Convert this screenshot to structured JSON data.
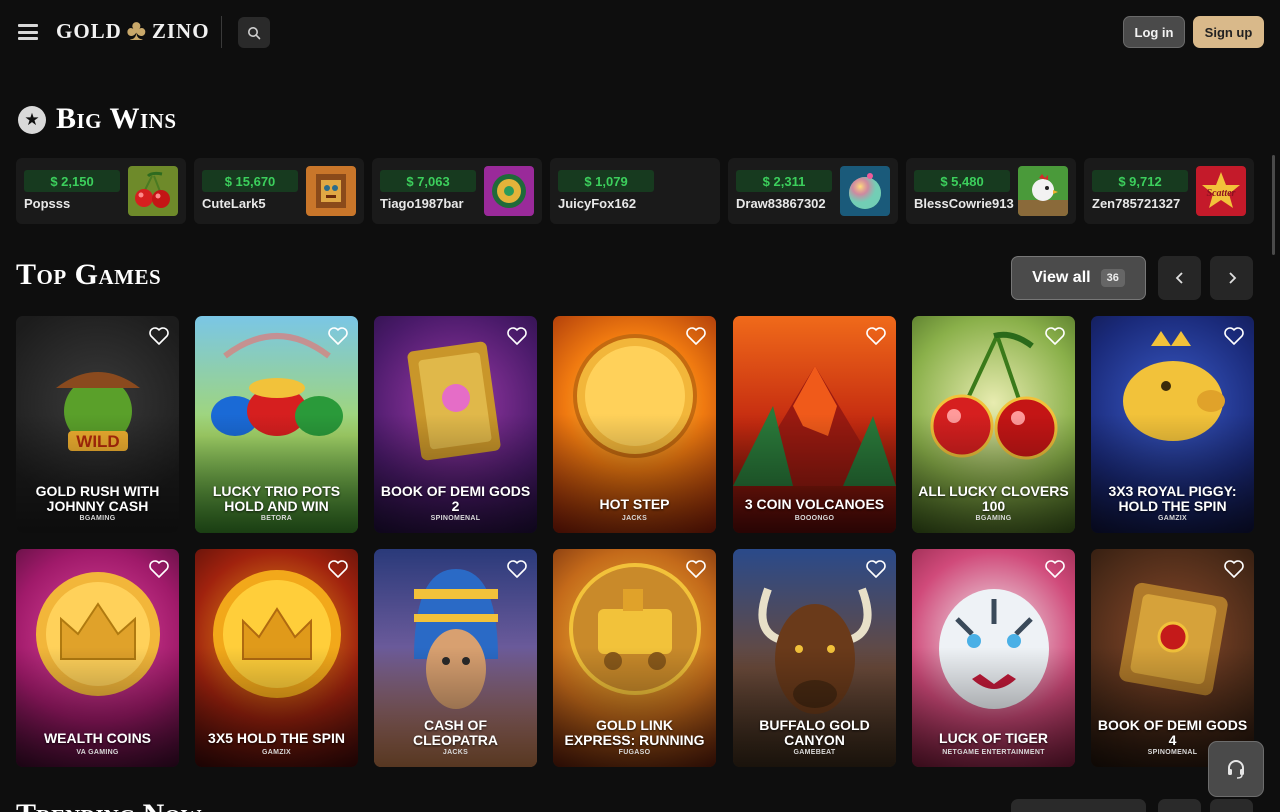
{
  "header": {
    "logo_left": "GOLD",
    "logo_right": "ZINO",
    "login_label": "Log in",
    "signup_label": "Sign up"
  },
  "big_wins": {
    "title": "Big Wins",
    "items": [
      {
        "amount": "$ 2,150",
        "user": "Popsss",
        "art": "cherries"
      },
      {
        "amount": "$ 15,670",
        "user": "CuteLark5",
        "art": "aztec"
      },
      {
        "amount": "$ 7,063",
        "user": "Tiago1987bar",
        "art": "purple"
      },
      {
        "amount": "$ 1,079",
        "user": "JuicyFox162",
        "art": "none"
      },
      {
        "amount": "$ 2,311",
        "user": "Draw83867302",
        "art": "bubble"
      },
      {
        "amount": "$ 5,480",
        "user": "BlessCowrie913",
        "art": "rooster"
      },
      {
        "amount": "$ 9,712",
        "user": "Zen785721327",
        "art": "scatter"
      }
    ]
  },
  "top_games": {
    "title": "Top Games",
    "view_all_label": "View all",
    "view_all_count": "36",
    "games": [
      {
        "name": "Gold Rush with Johnny Cash",
        "provider": "BGAMING",
        "art": "cowboy"
      },
      {
        "name": "Lucky Trio Pots Hold and Win",
        "provider": "BETORA",
        "art": "pots"
      },
      {
        "name": "Book of Demi Gods 2",
        "provider": "SPINOMENAL",
        "art": "book-purple"
      },
      {
        "name": "Hot Step",
        "provider": "JACKS",
        "art": "fire-coin"
      },
      {
        "name": "3 Coin Volcanoes",
        "provider": "BOOONGO",
        "art": "volcano"
      },
      {
        "name": "All Lucky Clovers 100",
        "provider": "BGAMING",
        "art": "cherries-big"
      },
      {
        "name": "3x3 Royal Piggy: Hold the Spin",
        "provider": "GAMZIX",
        "art": "piggy"
      },
      {
        "name": "Wealth Coins",
        "provider": "VA GAMING",
        "art": "crown-coin"
      },
      {
        "name": "3x5 Hold the Spin",
        "provider": "GAMZIX",
        "art": "sun-coin"
      },
      {
        "name": "Cash of Cleopatra",
        "provider": "JACKS",
        "art": "cleopatra"
      },
      {
        "name": "Gold Link Express: Running",
        "provider": "FUGASO",
        "art": "train"
      },
      {
        "name": "Buffalo Gold Canyon",
        "provider": "GAMEBEAT",
        "art": "buffalo"
      },
      {
        "name": "Luck of Tiger",
        "provider": "NETGAME ENTERTAINMENT",
        "art": "tiger"
      },
      {
        "name": "Book of Demi Gods 4",
        "provider": "SPINOMENAL",
        "art": "book-gold"
      }
    ]
  },
  "next_section": {
    "title": "Trending Now"
  },
  "colors": {
    "background": "#0e0e0e",
    "card": "#1a1a1a",
    "win_green": "#3ccf5c",
    "signup_gold": "#d9b98a"
  }
}
